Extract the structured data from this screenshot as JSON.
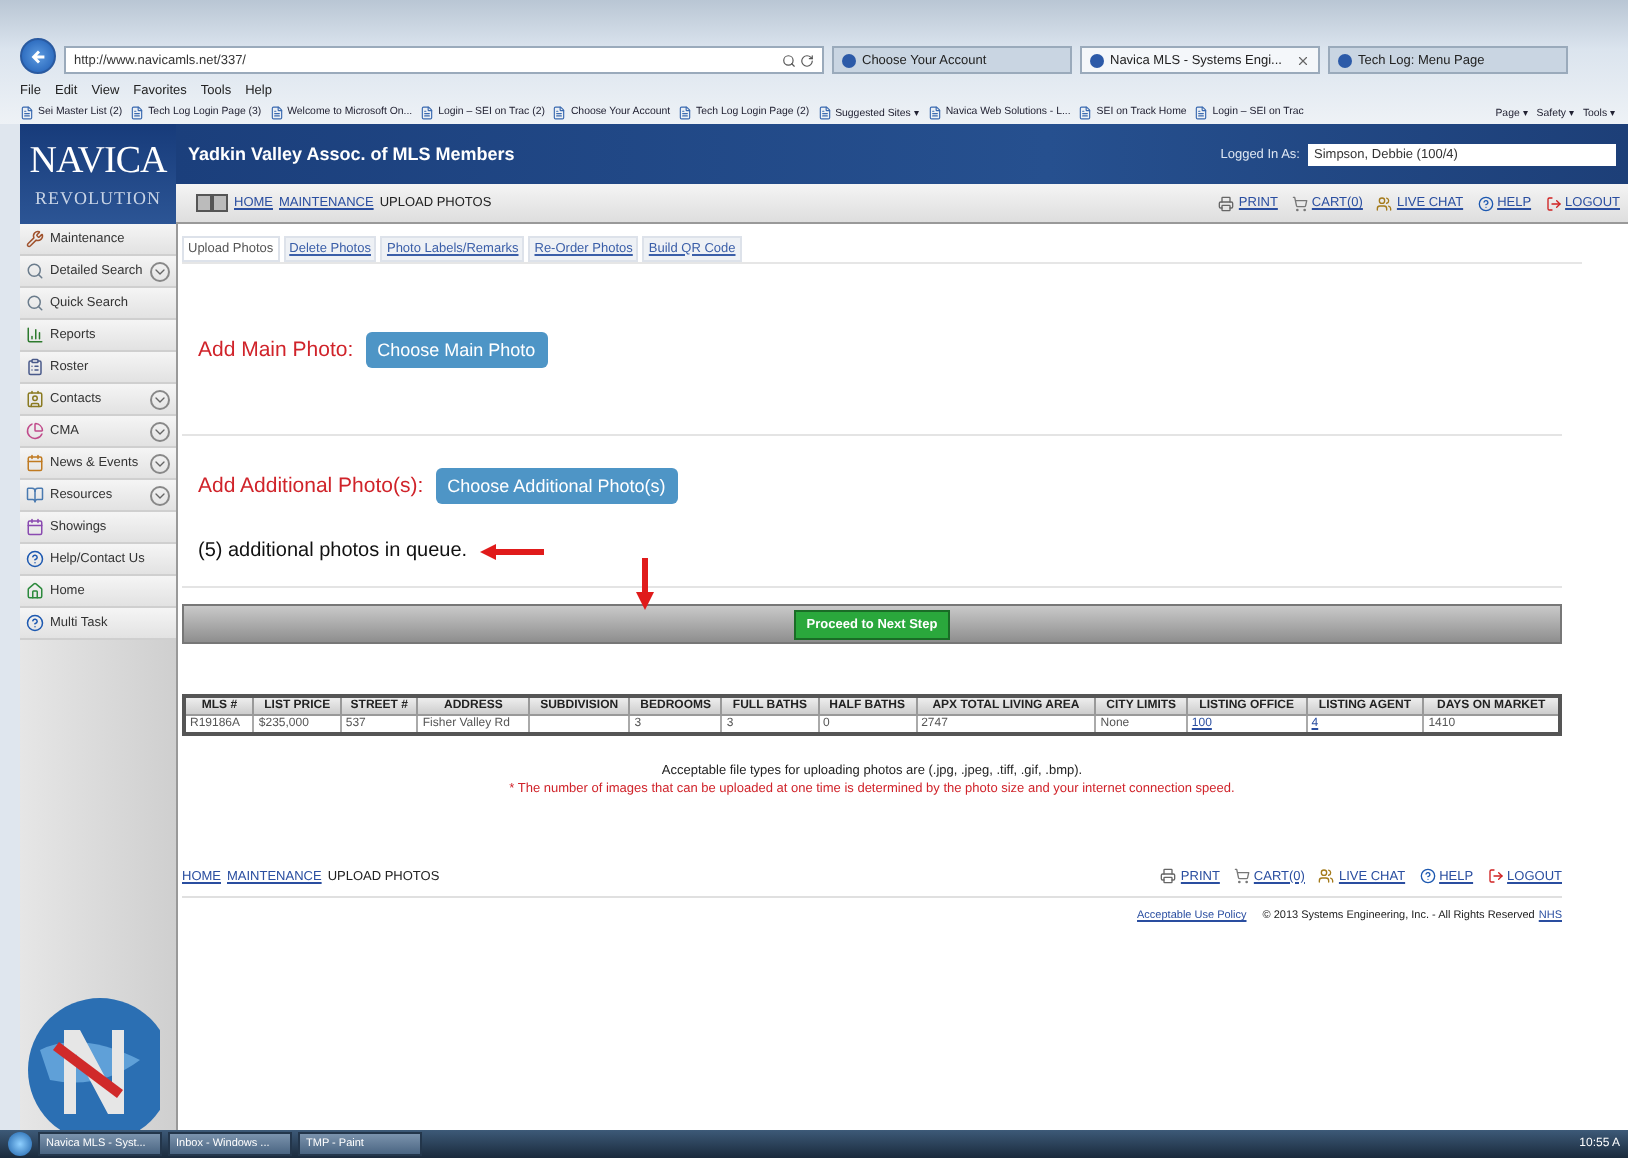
{
  "browser": {
    "address": "http://www.navicamls.net/337/",
    "tabs": [
      {
        "title": "Choose Your Account",
        "selected": false,
        "closable": false
      },
      {
        "title": "Navica MLS - Systems Engi...",
        "selected": true,
        "closable": true
      },
      {
        "title": "Tech Log: Menu Page",
        "selected": false,
        "closable": false
      }
    ],
    "menu": [
      "File",
      "Edit",
      "View",
      "Favorites",
      "Tools",
      "Help"
    ],
    "favorites": [
      "Sei Master List (2)",
      "Tech Log Login Page (3)",
      "Welcome to Microsoft On...",
      "Login – SEI on Trac (2)",
      "Choose Your Account",
      "Tech Log Login Page (2)",
      "Suggested Sites ▾",
      "Navica Web Solutions - L...",
      "SEI on Track Home",
      "Login – SEI on Trac"
    ],
    "commands": [
      "Page ▾",
      "Safety ▾",
      "Tools ▾"
    ]
  },
  "header": {
    "logo": "NAVICA",
    "logo_sub": "REVOLUTION",
    "title": "Yadkin Valley Assoc. of MLS Members",
    "login_label": "Logged In As:",
    "login_value": "Simpson, Debbie (100/4)"
  },
  "breadcrumb": [
    {
      "text": "HOME",
      "link": true
    },
    {
      "text": "MAINTENANCE",
      "link": true
    },
    {
      "text": "UPLOAD PHOTOS",
      "link": false
    }
  ],
  "actions": [
    {
      "kind": "print",
      "label": "PRINT"
    },
    {
      "kind": "cart",
      "label": "CART(0)"
    },
    {
      "kind": "chat",
      "label": "LIVE CHAT"
    },
    {
      "kind": "help",
      "label": "HELP"
    },
    {
      "kind": "logout",
      "label": "LOGOUT"
    }
  ],
  "sidebar": [
    {
      "kind": "maintenance",
      "label": "Maintenance",
      "expandable": false
    },
    {
      "kind": "search",
      "label": "Detailed Search",
      "expandable": true
    },
    {
      "kind": "search",
      "label": "Quick Search",
      "expandable": false
    },
    {
      "kind": "reports",
      "label": "Reports",
      "expandable": false
    },
    {
      "kind": "roster",
      "label": "Roster",
      "expandable": false
    },
    {
      "kind": "contacts",
      "label": "Contacts",
      "expandable": true
    },
    {
      "kind": "cma",
      "label": "CMA",
      "expandable": true
    },
    {
      "kind": "news",
      "label": "News & Events",
      "expandable": true
    },
    {
      "kind": "resources",
      "label": "Resources",
      "expandable": true
    },
    {
      "kind": "showings",
      "label": "Showings",
      "expandable": false
    },
    {
      "kind": "help",
      "label": "Help/Contact Us",
      "expandable": false
    },
    {
      "kind": "home",
      "label": "Home",
      "expandable": false
    },
    {
      "kind": "help",
      "label": "Multi Task",
      "expandable": false
    }
  ],
  "page_tabs": [
    {
      "label": "Upload Photos",
      "selected": true
    },
    {
      "label": "Delete Photos",
      "selected": false
    },
    {
      "label": "Photo Labels/Remarks",
      "selected": false
    },
    {
      "label": "Re-Order Photos",
      "selected": false
    },
    {
      "label": "Build QR Code",
      "selected": false
    }
  ],
  "main_photo": {
    "label": "Add Main Photo:",
    "button": "Choose Main Photo"
  },
  "additional_photos": {
    "label": "Add Additional Photo(s):",
    "button": "Choose Additional Photo(s)"
  },
  "queue": "(5) additional photos in queue.",
  "proceed": "Proceed to Next Step",
  "table": {
    "columns": [
      {
        "label": "MLS #"
      },
      {
        "label": "LIST PRICE"
      },
      {
        "label": "STREET #"
      },
      {
        "label": "ADDRESS"
      },
      {
        "label": "SUBDIVISION"
      },
      {
        "label": "BEDROOMS"
      },
      {
        "label": "FULL BATHS"
      },
      {
        "label": "HALF BATHS"
      },
      {
        "label": "APX TOTAL LIVING AREA"
      },
      {
        "label": "CITY LIMITS"
      },
      {
        "label": "LISTING OFFICE",
        "link": true
      },
      {
        "label": "LISTING AGENT",
        "link": true
      },
      {
        "label": "DAYS ON MARKET"
      }
    ],
    "rows": [
      [
        "R19186A",
        "$235,000",
        "537",
        "Fisher Valley Rd",
        "",
        "3",
        "3",
        "0",
        "2747",
        "None",
        "100",
        "4",
        "1410"
      ]
    ]
  },
  "notes": {
    "file_types": "Acceptable file types for uploading photos are (.jpg, .jpeg, .tiff, .gif, .bmp).",
    "warning": "* The number of images that can be uploaded at one time is determined by the photo size and your internet connection speed."
  },
  "footer": {
    "breadcrumb": [
      {
        "text": "HOME",
        "link": true
      },
      {
        "text": "MAINTENANCE",
        "link": true
      },
      {
        "text": "UPLOAD PHOTOS",
        "link": false
      }
    ],
    "actions": [
      {
        "kind": "print",
        "label": "PRINT"
      },
      {
        "kind": "cart",
        "label": "CART(0)"
      },
      {
        "kind": "chat",
        "label": "LIVE CHAT"
      },
      {
        "kind": "help",
        "label": "HELP"
      },
      {
        "kind": "logout",
        "label": "LOGOUT"
      }
    ],
    "policy_link": "Acceptable Use Policy",
    "copyright": "© 2013 Systems Engineering, Inc. - All Rights Reserved",
    "copyright_link": "NHS"
  },
  "taskbar": {
    "tasks": [
      "Navica MLS - Syst...",
      "Inbox - Windows ...",
      "TMP - Paint"
    ],
    "clock": "10:55 A"
  }
}
